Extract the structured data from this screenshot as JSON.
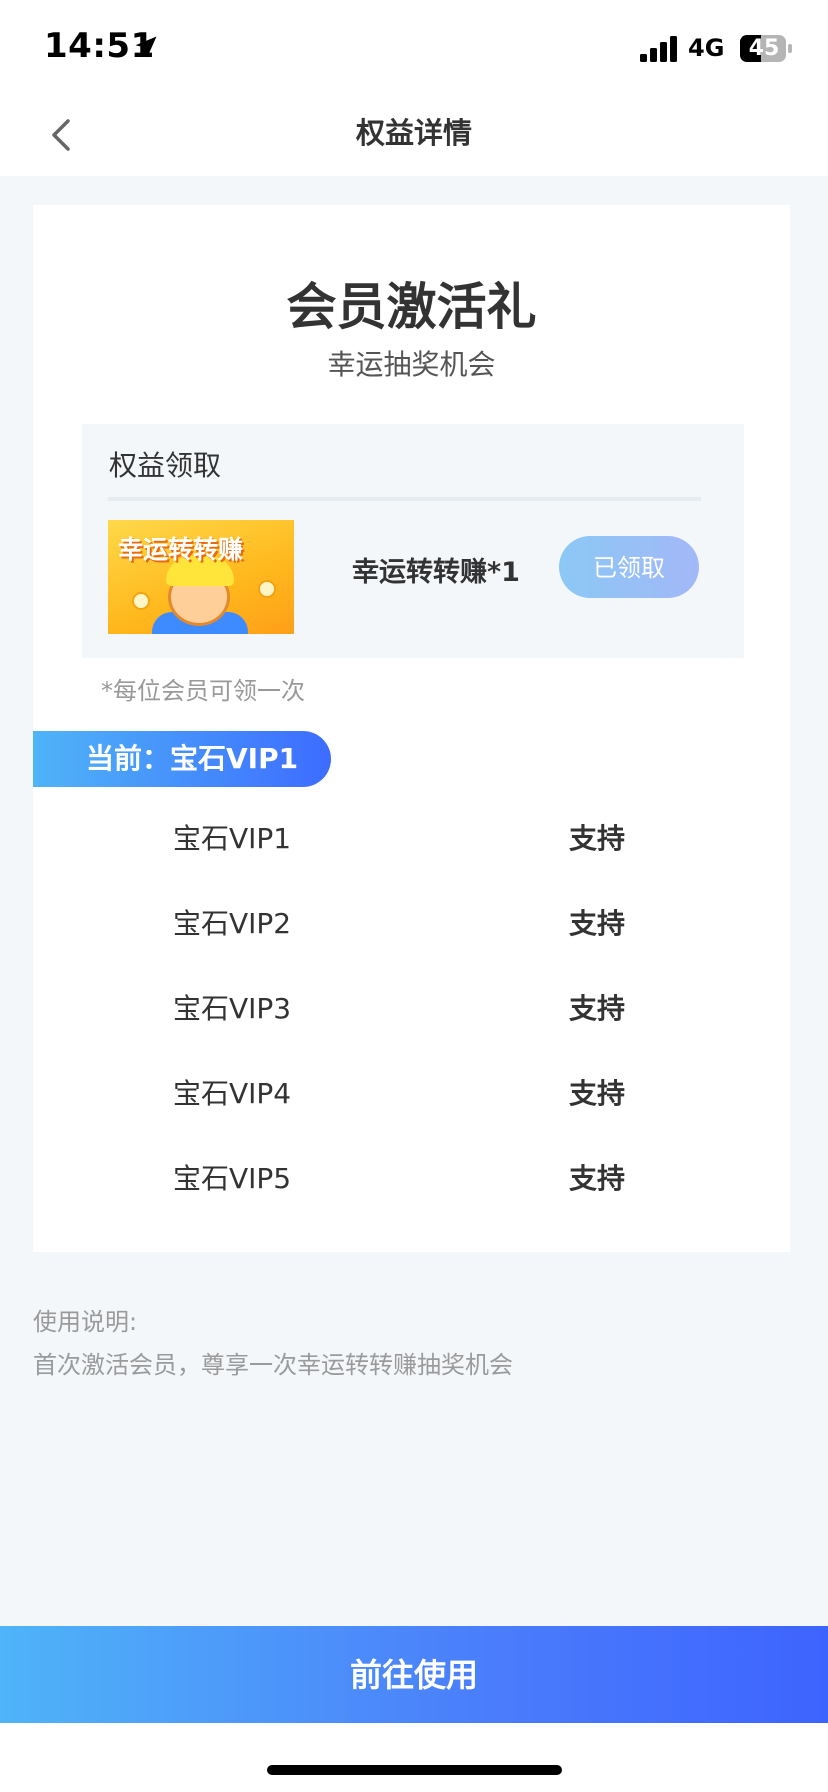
{
  "status_bar": {
    "time": "14:51",
    "network": "4G",
    "battery": "45"
  },
  "nav": {
    "title": "权益详情"
  },
  "card": {
    "title": "会员激活礼",
    "subtitle": "幸运抽奖机会",
    "claim_section": {
      "label": "权益领取",
      "reward": {
        "image_text": "幸运转转赚",
        "name": "幸运转转赚*1",
        "button_label": "已领取"
      },
      "note": "*每位会员可领一次"
    },
    "current_tier": "当前：宝石VIP1",
    "tiers": [
      {
        "name": "宝石VIP1",
        "status": "支持"
      },
      {
        "name": "宝石VIP2",
        "status": "支持"
      },
      {
        "name": "宝石VIP3",
        "status": "支持"
      },
      {
        "name": "宝石VIP4",
        "status": "支持"
      },
      {
        "name": "宝石VIP5",
        "status": "支持"
      }
    ]
  },
  "usage": {
    "title": "使用说明:",
    "text": "首次激活会员，尊享一次幸运转转赚抽奖机会"
  },
  "action": {
    "button_label": "前往使用"
  },
  "colors": {
    "accent_start": "#4fb4f8",
    "accent_end": "#3d64ff",
    "page_bg": "#f4f7fa"
  }
}
